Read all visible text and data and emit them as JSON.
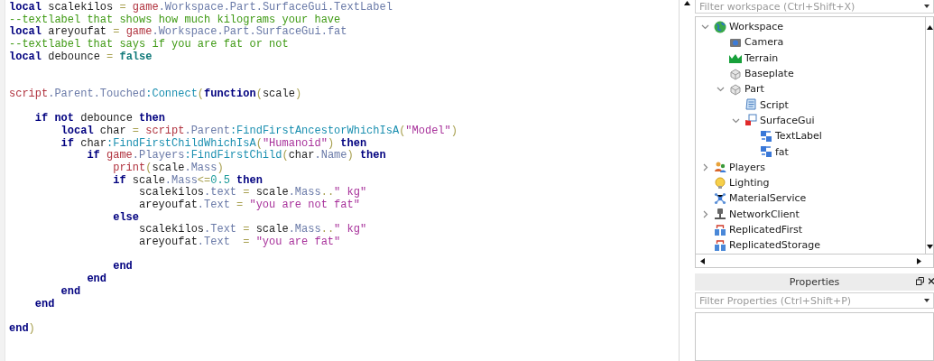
{
  "editor": {
    "lines": [
      {
        "kind": "code",
        "tokens": [
          {
            "kind": "kw",
            "text": "local"
          },
          {
            "kind": "plain",
            "text": " scalekilos "
          },
          {
            "kind": "op",
            "text": "= "
          },
          {
            "kind": "global",
            "text": "game"
          },
          {
            "kind": "prop",
            "text": ".Workspace.Part.SurfaceGui.TextLabel"
          }
        ]
      },
      {
        "kind": "code",
        "tokens": [
          {
            "kind": "comment",
            "text": "--textlabel that shows how much kilograms your have"
          }
        ]
      },
      {
        "kind": "code",
        "tokens": [
          {
            "kind": "kw",
            "text": "local"
          },
          {
            "kind": "plain",
            "text": " areyoufat "
          },
          {
            "kind": "op",
            "text": "= "
          },
          {
            "kind": "global",
            "text": "game"
          },
          {
            "kind": "prop",
            "text": ".Workspace.Part.SurfaceGui.fat"
          }
        ]
      },
      {
        "kind": "code",
        "tokens": [
          {
            "kind": "comment",
            "text": "--textlabel that says if you are fat or not"
          }
        ]
      },
      {
        "kind": "code",
        "tokens": [
          {
            "kind": "kw",
            "text": "local"
          },
          {
            "kind": "plain",
            "text": " debounce "
          },
          {
            "kind": "op",
            "text": "= "
          },
          {
            "kind": "bool",
            "text": "false"
          }
        ]
      },
      {
        "kind": "blank"
      },
      {
        "kind": "blank"
      },
      {
        "kind": "code",
        "tokens": [
          {
            "kind": "global",
            "text": "script"
          },
          {
            "kind": "prop",
            "text": ".Parent.Touched"
          },
          {
            "kind": "method",
            "text": ":Connect"
          },
          {
            "kind": "op",
            "text": "("
          },
          {
            "kind": "kw",
            "text": "function"
          },
          {
            "kind": "op",
            "text": "("
          },
          {
            "kind": "plain",
            "text": "scale"
          },
          {
            "kind": "op",
            "text": ")"
          }
        ],
        "children": [
          {
            "kind": "blank"
          },
          {
            "kind": "code",
            "tokens": [
              {
                "kind": "kw",
                "text": "if not"
              },
              {
                "kind": "plain",
                "text": " debounce "
              },
              {
                "kind": "kw",
                "text": "then"
              }
            ],
            "children": [
              {
                "kind": "code",
                "tokens": [
                  {
                    "kind": "kw",
                    "text": "local"
                  },
                  {
                    "kind": "plain",
                    "text": " char "
                  },
                  {
                    "kind": "op",
                    "text": "= "
                  },
                  {
                    "kind": "global",
                    "text": "script"
                  },
                  {
                    "kind": "prop",
                    "text": ".Parent"
                  },
                  {
                    "kind": "method",
                    "text": ":FindFirstAncestorWhichIsA"
                  },
                  {
                    "kind": "op",
                    "text": "("
                  },
                  {
                    "kind": "str",
                    "text": "\"Model\""
                  },
                  {
                    "kind": "op",
                    "text": ")"
                  }
                ]
              },
              {
                "kind": "code",
                "tokens": [
                  {
                    "kind": "kw",
                    "text": "if"
                  },
                  {
                    "kind": "plain",
                    "text": " char"
                  },
                  {
                    "kind": "method",
                    "text": ":FindFirstChildWhichIsA"
                  },
                  {
                    "kind": "op",
                    "text": "("
                  },
                  {
                    "kind": "str",
                    "text": "\"Humanoid\""
                  },
                  {
                    "kind": "op",
                    "text": ") "
                  },
                  {
                    "kind": "kw",
                    "text": "then"
                  }
                ],
                "children": [
                  {
                    "kind": "code",
                    "tokens": [
                      {
                        "kind": "kw",
                        "text": "if "
                      },
                      {
                        "kind": "global",
                        "text": "game"
                      },
                      {
                        "kind": "prop",
                        "text": ".Players"
                      },
                      {
                        "kind": "method",
                        "text": ":FindFirstChild"
                      },
                      {
                        "kind": "op",
                        "text": "("
                      },
                      {
                        "kind": "plain",
                        "text": "char"
                      },
                      {
                        "kind": "prop",
                        "text": ".Name"
                      },
                      {
                        "kind": "op",
                        "text": ") "
                      },
                      {
                        "kind": "kw",
                        "text": "then"
                      }
                    ],
                    "children": [
                      {
                        "kind": "code",
                        "tokens": [
                          {
                            "kind": "global",
                            "text": "print"
                          },
                          {
                            "kind": "op",
                            "text": "("
                          },
                          {
                            "kind": "plain",
                            "text": "scale"
                          },
                          {
                            "kind": "prop",
                            "text": ".Mass"
                          },
                          {
                            "kind": "op",
                            "text": ")"
                          }
                        ]
                      },
                      {
                        "kind": "code",
                        "tokens": [
                          {
                            "kind": "kw",
                            "text": "if"
                          },
                          {
                            "kind": "plain",
                            "text": " scale"
                          },
                          {
                            "kind": "prop",
                            "text": ".Mass"
                          },
                          {
                            "kind": "op",
                            "text": "<="
                          },
                          {
                            "kind": "num",
                            "text": "0.5"
                          },
                          {
                            "kind": "kw",
                            "text": " then"
                          }
                        ],
                        "children": [
                          {
                            "kind": "code",
                            "tokens": [
                              {
                                "kind": "plain",
                                "text": "scalekilos"
                              },
                              {
                                "kind": "prop",
                                "text": ".text"
                              },
                              {
                                "kind": "op",
                                "text": " = "
                              },
                              {
                                "kind": "plain",
                                "text": "scale"
                              },
                              {
                                "kind": "prop",
                                "text": ".Mass"
                              },
                              {
                                "kind": "op",
                                "text": ".."
                              },
                              {
                                "kind": "str",
                                "text": "\" kg\""
                              }
                            ]
                          },
                          {
                            "kind": "code",
                            "tokens": [
                              {
                                "kind": "plain",
                                "text": "areyoufat"
                              },
                              {
                                "kind": "prop",
                                "text": ".Text"
                              },
                              {
                                "kind": "op",
                                "text": " = "
                              },
                              {
                                "kind": "str",
                                "text": "\"you are not fat\""
                              }
                            ]
                          }
                        ]
                      },
                      {
                        "kind": "code",
                        "tokens": [
                          {
                            "kind": "kw",
                            "text": "else"
                          }
                        ],
                        "children": [
                          {
                            "kind": "code",
                            "tokens": [
                              {
                                "kind": "plain",
                                "text": "scalekilos"
                              },
                              {
                                "kind": "prop",
                                "text": ".Text"
                              },
                              {
                                "kind": "op",
                                "text": " = "
                              },
                              {
                                "kind": "plain",
                                "text": "scale"
                              },
                              {
                                "kind": "prop",
                                "text": ".Mass"
                              },
                              {
                                "kind": "op",
                                "text": ".."
                              },
                              {
                                "kind": "str",
                                "text": "\" kg\""
                              }
                            ]
                          },
                          {
                            "kind": "code",
                            "tokens": [
                              {
                                "kind": "plain",
                                "text": "areyoufat"
                              },
                              {
                                "kind": "prop",
                                "text": ".Text"
                              },
                              {
                                "kind": "op",
                                "text": "  = "
                              },
                              {
                                "kind": "str",
                                "text": "\"you are fat\""
                              }
                            ]
                          },
                          {
                            "kind": "blank"
                          }
                        ]
                      },
                      {
                        "kind": "code",
                        "tokens": [
                          {
                            "kind": "kw",
                            "text": "end"
                          }
                        ]
                      }
                    ]
                  },
                  {
                    "kind": "code",
                    "tokens": [
                      {
                        "kind": "kw",
                        "text": "end"
                      }
                    ]
                  }
                ]
              },
              {
                "kind": "code",
                "tokens": [
                  {
                    "kind": "kw",
                    "text": "end"
                  }
                ]
              }
            ]
          },
          {
            "kind": "code",
            "tokens": [
              {
                "kind": "kw",
                "text": "end"
              }
            ]
          }
        ]
      },
      {
        "kind": "blank"
      },
      {
        "kind": "code",
        "tokens": [
          {
            "kind": "kw",
            "text": "end"
          },
          {
            "kind": "op",
            "text": ")"
          }
        ]
      }
    ]
  },
  "explorer": {
    "filter": {
      "placeholder": "Filter workspace (Ctrl+Shift+X)"
    },
    "tree": [
      {
        "label": "Workspace",
        "kind": "globe",
        "expanded": true,
        "children": [
          {
            "label": "Camera",
            "kind": "camera"
          },
          {
            "label": "Terrain",
            "kind": "terrain"
          },
          {
            "label": "Baseplate",
            "kind": "brick"
          },
          {
            "label": "Part",
            "kind": "brick",
            "expanded": true,
            "children": [
              {
                "label": "Script",
                "kind": "script"
              },
              {
                "label": "SurfaceGui",
                "kind": "surfacegui",
                "expanded": true,
                "children": [
                  {
                    "label": "TextLabel",
                    "kind": "textlabel"
                  },
                  {
                    "label": "fat",
                    "kind": "textlabel"
                  }
                ]
              }
            ]
          }
        ]
      },
      {
        "label": "Players",
        "kind": "players",
        "expanded": false
      },
      {
        "label": "Lighting",
        "kind": "lighting"
      },
      {
        "label": "MaterialService",
        "kind": "material"
      },
      {
        "label": "NetworkClient",
        "kind": "network",
        "expanded": false
      },
      {
        "label": "ReplicatedFirst",
        "kind": "replicated"
      },
      {
        "label": "ReplicatedStorage",
        "kind": "replicated"
      }
    ]
  },
  "properties": {
    "title": "Properties",
    "filter": {
      "placeholder": "Filter Properties (Ctrl+Shift+P)"
    }
  }
}
